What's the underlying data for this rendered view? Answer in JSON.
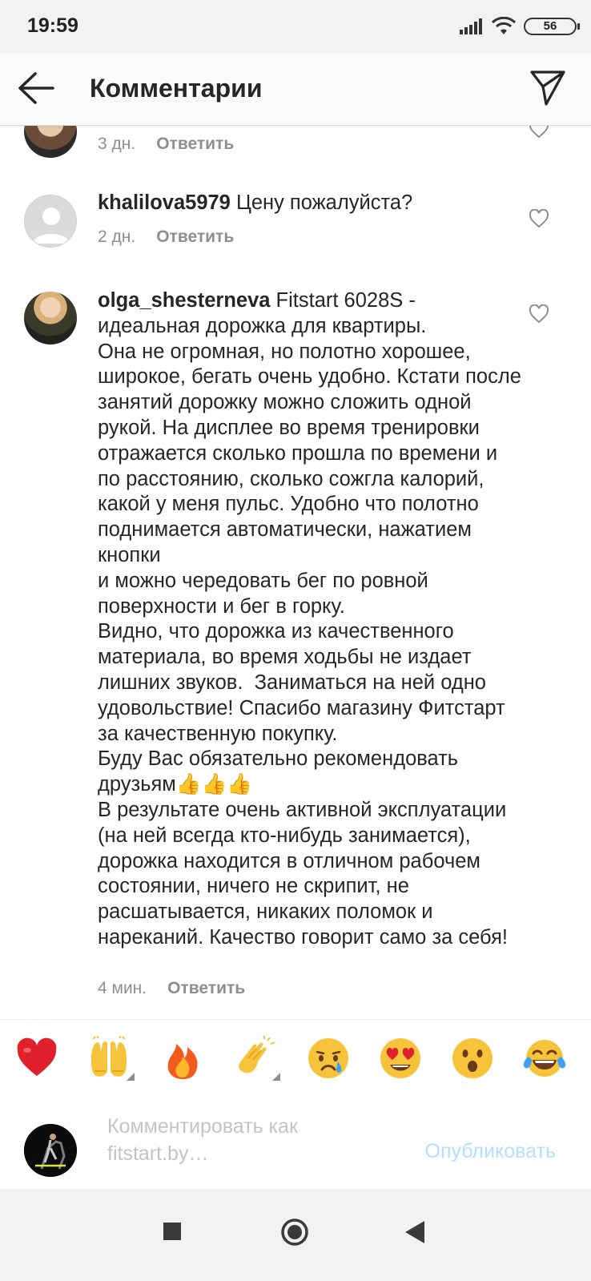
{
  "status_bar": {
    "time": "19:59",
    "battery": "56",
    "icons": [
      "signal-icon",
      "wifi-icon",
      "battery-icon"
    ]
  },
  "header": {
    "title": "Комментарии",
    "icons": [
      "back-arrow-icon",
      "send-direct-icon"
    ]
  },
  "comments": [
    {
      "username": "",
      "text": "",
      "time": "3 дн.",
      "reply_label": "Ответить"
    },
    {
      "username": "khalilova5979",
      "text": " Цену пожалуйста?",
      "time": "2 дн.",
      "reply_label": "Ответить"
    },
    {
      "username": "olga_shesterneva",
      "text": " Fitstart 6028S - идеальная дорожка для квартиры.\nОна не огромная, но полотно хорошее, широкое, бегать очень удобно. Кстати после занятий дорожку можно сложить одной рукой. На дисплее во время тренировки отражается сколько прошла по времени и по расстоянию, сколько сожгла калорий, какой у меня пульс. Удобно что полотно поднимается автоматически, нажатием кнопки\nи можно чередовать бег по ровной поверхности и бег в горку.\nВидно, что дорожка из качественного материала, во время ходьбы не издает лишних звуков.  Заниматься на ней одно удовольствие! Спасибо магазину Фитстарт за качественную покупку.\nБуду Вас обязательно рекомендовать друзьям👍👍👍\nВ результате очень активной эксплуатации (на ней всегда кто-нибудь занимается), дорожка находится в отличном рабочем состоянии, ничего не скрипит, не расшатывается, никаких поломок и нареканий. Качество говорит само за себя!",
      "time": "4 мин.",
      "reply_label": "Ответить"
    }
  ],
  "emoji_bar": [
    "❤️",
    "🙌",
    "🔥",
    "👏",
    "😢",
    "😍",
    "😮",
    "😂"
  ],
  "compose": {
    "placeholder": "Комментировать как fitstart.by…",
    "publish_label": "Опубликовать",
    "publish_color": "#b2dffc"
  },
  "nav_bar": {
    "icons": [
      "recents-square-icon",
      "home-circle-icon",
      "back-triangle-icon"
    ]
  }
}
